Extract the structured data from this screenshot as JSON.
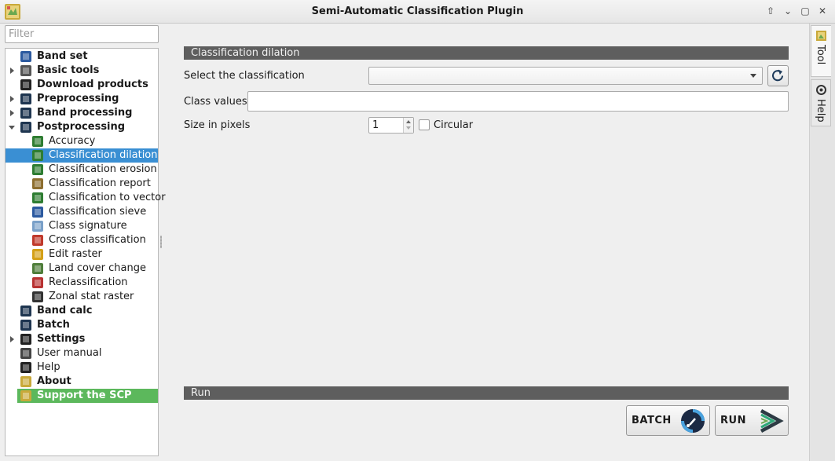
{
  "window": {
    "title": "Semi-Automatic Classification Plugin",
    "controls": [
      "⇧",
      "⌄",
      "▢",
      "✕"
    ]
  },
  "sidebar": {
    "filter_placeholder": "Filter",
    "items": [
      {
        "label": "Band set",
        "icon": "band-set-icon",
        "level": 0,
        "arrow": ""
      },
      {
        "label": "Basic tools",
        "icon": "basic-tools-icon",
        "level": 0,
        "arrow": "collapsed"
      },
      {
        "label": "Download products",
        "icon": "download-icon",
        "level": 0,
        "arrow": ""
      },
      {
        "label": "Preprocessing",
        "icon": "preprocessing-icon",
        "level": 0,
        "arrow": "collapsed"
      },
      {
        "label": "Band processing",
        "icon": "band-processing-icon",
        "level": 0,
        "arrow": "collapsed"
      },
      {
        "label": "Postprocessing",
        "icon": "postprocessing-icon",
        "level": 0,
        "arrow": "expanded"
      },
      {
        "label": "Accuracy",
        "icon": "accuracy-icon",
        "level": 1
      },
      {
        "label": "Classification dilation",
        "icon": "classification-dilation-icon",
        "level": 1,
        "selected": true
      },
      {
        "label": "Classification erosion",
        "icon": "classification-erosion-icon",
        "level": 1
      },
      {
        "label": "Classification report",
        "icon": "classification-report-icon",
        "level": 1
      },
      {
        "label": "Classification to vector",
        "icon": "classification-to-vector-icon",
        "level": 1
      },
      {
        "label": "Classification sieve",
        "icon": "classification-sieve-icon",
        "level": 1
      },
      {
        "label": "Class signature",
        "icon": "class-signature-icon",
        "level": 1
      },
      {
        "label": "Cross classification",
        "icon": "cross-classification-icon",
        "level": 1
      },
      {
        "label": "Edit raster",
        "icon": "edit-raster-icon",
        "level": 1
      },
      {
        "label": "Land cover change",
        "icon": "land-cover-change-icon",
        "level": 1
      },
      {
        "label": "Reclassification",
        "icon": "reclassification-icon",
        "level": 1
      },
      {
        "label": "Zonal stat raster",
        "icon": "zonal-stat-icon",
        "level": 1
      },
      {
        "label": "Band calc",
        "icon": "band-calc-icon",
        "level": 0,
        "arrow": ""
      },
      {
        "label": "Batch",
        "icon": "batch-icon",
        "level": 0,
        "arrow": ""
      },
      {
        "label": "Settings",
        "icon": "settings-icon",
        "level": 0,
        "arrow": "collapsed"
      },
      {
        "label": "User manual",
        "icon": "user-manual-icon",
        "level": 0,
        "arrow": "",
        "normal": true
      },
      {
        "label": "Help",
        "icon": "help-icon",
        "level": 0,
        "arrow": "",
        "normal": true
      },
      {
        "label": "About",
        "icon": "about-icon",
        "level": 0,
        "arrow": ""
      },
      {
        "label": "Support the SCP",
        "icon": "support-icon",
        "level": 0,
        "arrow": "",
        "support": true
      }
    ]
  },
  "main": {
    "section_title": "Classification dilation",
    "select_classification_label": "Select the classification",
    "select_classification_value": "",
    "class_values_label": "Class values",
    "class_values_value": "",
    "size_label": "Size in pixels",
    "size_value": "1",
    "circular_label": "Circular",
    "circular_checked": false,
    "run_section_title": "Run",
    "batch_label": "BATCH",
    "run_label": "RUN"
  },
  "dock_tabs": [
    {
      "label": "Tool",
      "icon": "tool-tab-icon",
      "active": true
    },
    {
      "label": "Help",
      "icon": "help-tab-icon",
      "active": false
    }
  ],
  "colors": {
    "selection": "#3a8fd3",
    "support": "#5cb85c",
    "section_bar": "#5e5e5e"
  }
}
